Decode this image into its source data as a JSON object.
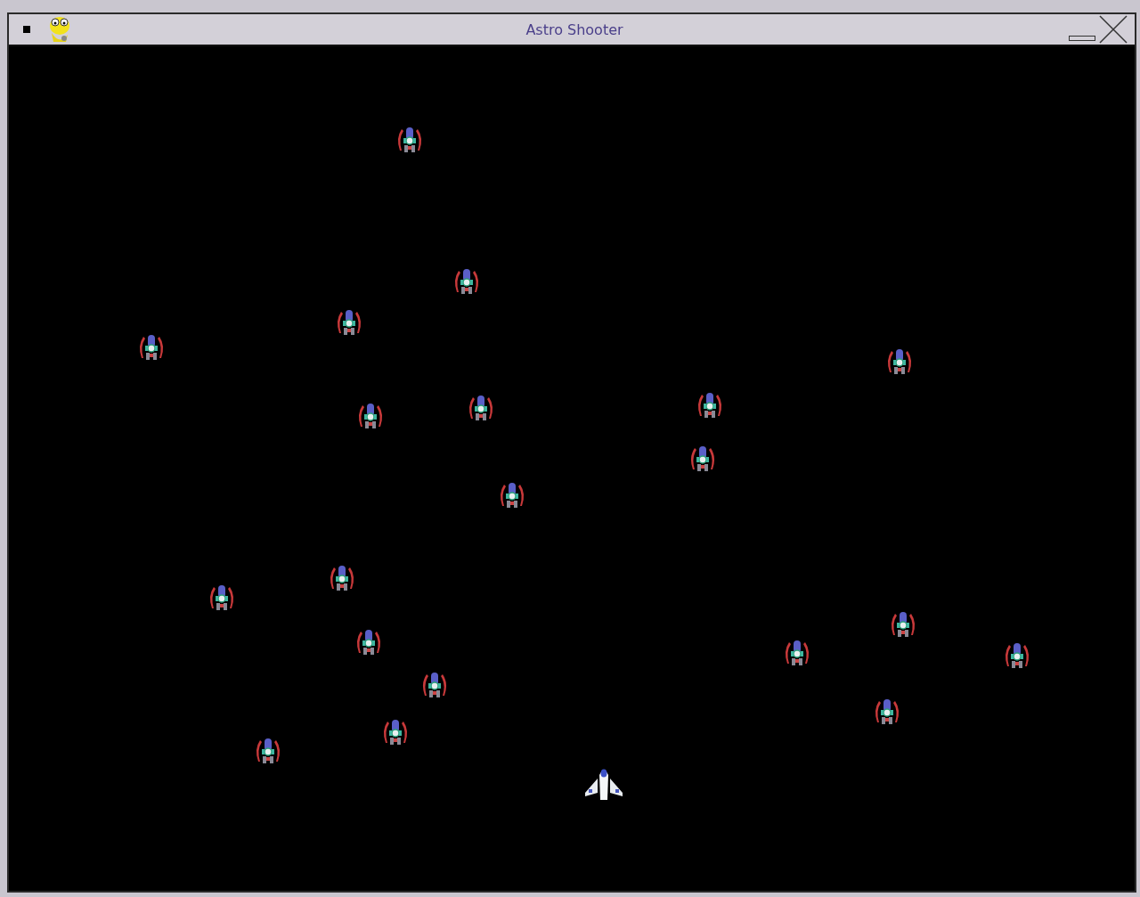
{
  "window": {
    "title": "Astro Shooter"
  }
}
